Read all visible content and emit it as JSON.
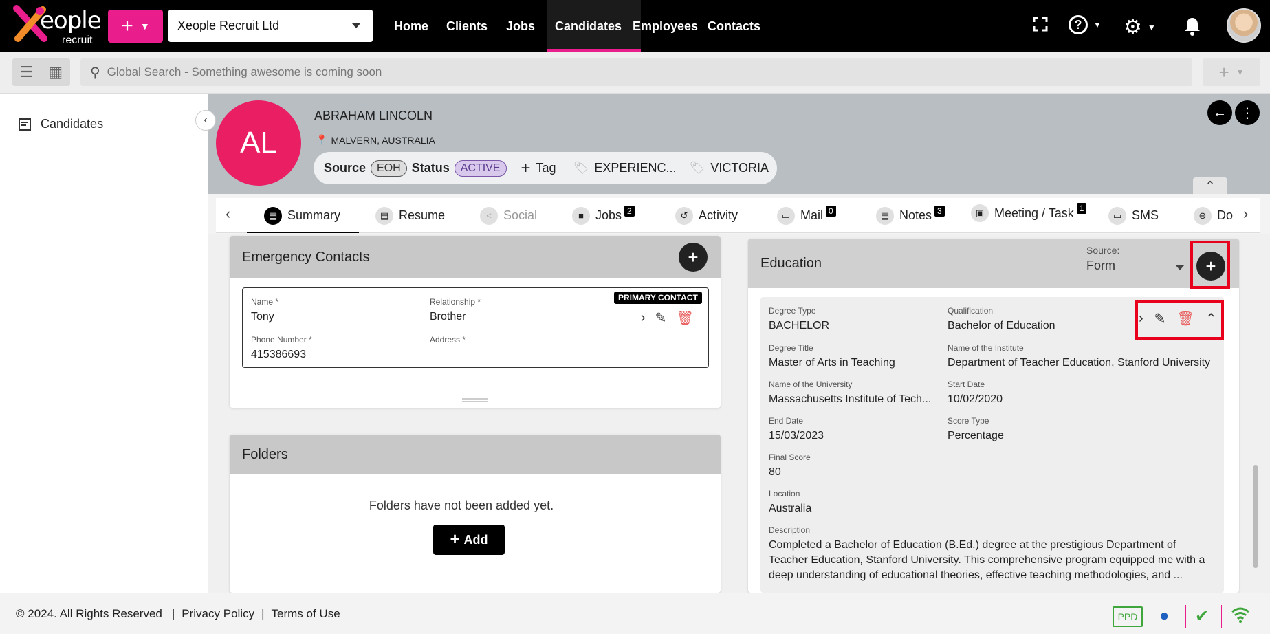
{
  "topbar": {
    "logo_text": "eople",
    "logo_sub": "recruit",
    "company": "Xeople Recruit Ltd",
    "nav": [
      "Home",
      "Clients",
      "Jobs",
      "Candidates",
      "Employees",
      "Contacts"
    ],
    "active_nav": "Candidates"
  },
  "search": {
    "placeholder": "Global Search - Something awesome is coming soon"
  },
  "sidebar": {
    "items": [
      {
        "label": "Candidates",
        "icon": "list-card-icon"
      }
    ]
  },
  "profile": {
    "initials": "AL",
    "name": "ABRAHAM LINCOLN",
    "location": "MALVERN, AUSTRALIA",
    "source_label": "Source",
    "source_value": "EOH",
    "status_label": "Status",
    "status_value": "ACTIVE",
    "tag_button": "Tag",
    "tags": [
      "EXPERIENC...",
      "VICTORIA"
    ]
  },
  "tabs": [
    {
      "label": "Summary",
      "count": null
    },
    {
      "label": "Resume",
      "count": null
    },
    {
      "label": "Social",
      "count": null
    },
    {
      "label": "Jobs",
      "count": "2"
    },
    {
      "label": "Activity",
      "count": null
    },
    {
      "label": "Mail",
      "count": "0"
    },
    {
      "label": "Notes",
      "count": "3"
    },
    {
      "label": "Meeting / Task",
      "count": "1"
    },
    {
      "label": "SMS",
      "count": null
    },
    {
      "label": "Do",
      "count": null
    }
  ],
  "emergency": {
    "title": "Emergency Contacts",
    "primary_badge": "PRIMARY CONTACT",
    "labels": {
      "name": "Name *",
      "relationship": "Relationship *",
      "phone": "Phone Number *",
      "address": "Address *"
    },
    "contact": {
      "name": "Tony",
      "relationship": "Brother",
      "phone": "415386693",
      "address": ""
    }
  },
  "folders": {
    "title": "Folders",
    "empty_text": "Folders have not been added yet.",
    "add_label": "Add"
  },
  "education": {
    "title": "Education",
    "source_label": "Source:",
    "source_value": "Form",
    "labels": {
      "degree_type": "Degree Type",
      "qualification": "Qualification",
      "degree_title": "Degree Title",
      "institute": "Name of the Institute",
      "university": "Name of the University",
      "start_date": "Start Date",
      "end_date": "End Date",
      "score_type": "Score Type",
      "final_score": "Final Score",
      "location": "Location",
      "description": "Description"
    },
    "record": {
      "degree_type": "BACHELOR",
      "qualification": "Bachelor of Education",
      "degree_title": "Master of Arts in Teaching",
      "institute": "Department of Teacher Education, Stanford University",
      "university": "Massachusetts Institute of Tech...",
      "start_date": "10/02/2020",
      "end_date": "15/03/2023",
      "score_type": "Percentage",
      "final_score": "80",
      "location": "Australia",
      "description_1": "Completed a Bachelor of Education (B.Ed.) degree at the prestigious Department of",
      "description_2": "Teacher Education, Stanford University. This comprehensive program equipped me with a",
      "description_3": "deep understanding of educational theories, effective teaching methodologies, and ..."
    }
  },
  "footer": {
    "copyright": "© 2024. All Rights Reserved",
    "privacy": "Privacy Policy",
    "terms": "Terms of Use",
    "ppd": "PPD"
  },
  "colors": {
    "brand": "#e91e8c",
    "highlight": "#e8001c",
    "avatar": "#e91e63"
  }
}
